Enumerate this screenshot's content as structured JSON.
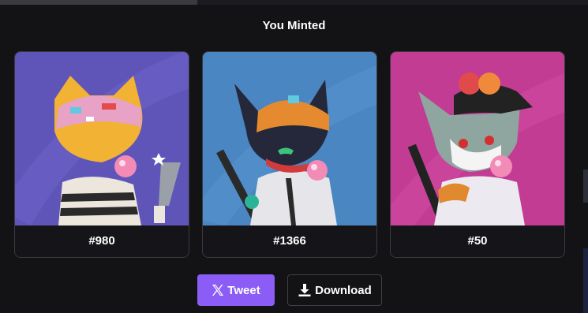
{
  "modal": {
    "title": "You Minted"
  },
  "cards": [
    {
      "label": "#980",
      "bg": "#5f55b9",
      "accent": "#f2b233"
    },
    {
      "label": "#1366",
      "bg": "#4a86c2",
      "accent": "#e58a2e"
    },
    {
      "label": "#50",
      "bg": "#c23c94",
      "accent": "#e04a4a"
    }
  ],
  "actions": {
    "tweet_label": "Tweet",
    "tweet_icon": "x-logo-icon",
    "download_label": "Download",
    "download_icon": "download-icon"
  },
  "colors": {
    "tweet_button": "#8b5cf6",
    "background": "#131316"
  }
}
